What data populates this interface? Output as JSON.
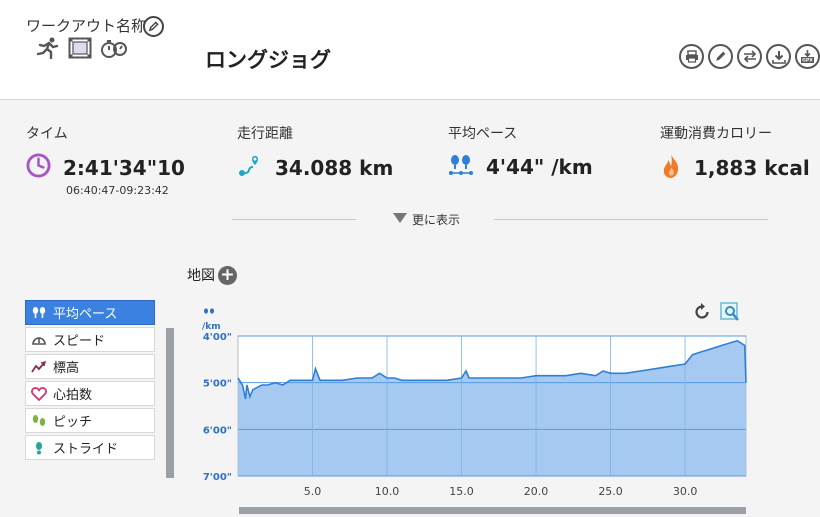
{
  "header": {
    "workout_name_label": "ワークアウト名称",
    "title": "ロングジョグ",
    "tools": [
      "print-icon",
      "edit-icon",
      "swap-icon",
      "download-icon",
      "gpx-export-icon"
    ]
  },
  "stats": {
    "time": {
      "label": "タイム",
      "value": "2:41'34\"10",
      "range": "06:40:47-09:23:42",
      "icon": "clock-icon",
      "color": "#a855c7"
    },
    "distance": {
      "label": "走行距離",
      "value": "34.088 km",
      "icon": "route-icon",
      "color": "#1aa7c9"
    },
    "pace": {
      "label": "平均ペース",
      "value": "4'44\" /km",
      "icon": "pace-icon",
      "color": "#2f7fd8"
    },
    "calories": {
      "label": "運動消費カロリー",
      "value": "1,883 kcal",
      "icon": "flame-icon",
      "color": "#f07a2a"
    },
    "more_label": "更に表示"
  },
  "map": {
    "label": "地図"
  },
  "metrics": [
    {
      "label": "平均ペース",
      "icon": "pace-icon",
      "active": true
    },
    {
      "label": "スピード",
      "icon": "speedometer-icon",
      "active": false
    },
    {
      "label": "標高",
      "icon": "elevation-icon",
      "active": false
    },
    {
      "label": "心拍数",
      "icon": "heart-icon",
      "active": false
    },
    {
      "label": "ピッチ",
      "icon": "footsteps-icon",
      "active": false
    },
    {
      "label": "ストライド",
      "icon": "stride-icon",
      "active": false
    }
  ],
  "chart_data": {
    "type": "area",
    "y_unit": "/km",
    "y_ticks": [
      "4'00\"",
      "5'00\"",
      "6'00\"",
      "7'00\""
    ],
    "y_tick_values": [
      4,
      5,
      6,
      7
    ],
    "ylim": [
      4,
      7
    ],
    "y_inverted": true,
    "xlim": [
      0,
      34.088
    ],
    "x_ticks": [
      "5.0",
      "10.0",
      "15.0",
      "20.0",
      "25.0",
      "30.0"
    ],
    "x_tick_values": [
      5,
      10,
      15,
      20,
      25,
      30
    ],
    "grid": true,
    "color": "#2f7fd8",
    "fill": "#a6c9f2",
    "x": [
      0,
      0.3,
      0.5,
      0.6,
      0.8,
      1.0,
      1.3,
      1.6,
      2.0,
      2.5,
      3.0,
      3.5,
      4.0,
      4.5,
      5.0,
      5.2,
      5.5,
      6.0,
      7.0,
      8.0,
      9.0,
      9.5,
      10.0,
      10.5,
      11.0,
      12.0,
      13.0,
      14.0,
      15.0,
      15.3,
      15.5,
      16.0,
      17.0,
      18.0,
      19.0,
      20.0,
      21.0,
      22.0,
      23.0,
      24.0,
      24.5,
      25.0,
      26.0,
      27.0,
      28.0,
      29.0,
      30.0,
      30.5,
      31.0,
      31.5,
      32.0,
      32.5,
      33.0,
      33.5,
      34.0,
      34.088
    ],
    "y": [
      4.9,
      5.05,
      5.35,
      5.05,
      5.3,
      5.15,
      5.1,
      5.05,
      5.05,
      5.0,
      5.05,
      4.95,
      4.95,
      4.95,
      4.95,
      4.7,
      4.95,
      4.95,
      4.95,
      4.9,
      4.9,
      4.8,
      4.9,
      4.9,
      4.95,
      4.95,
      4.95,
      4.95,
      4.9,
      4.75,
      4.9,
      4.9,
      4.9,
      4.9,
      4.9,
      4.85,
      4.85,
      4.85,
      4.8,
      4.85,
      4.75,
      4.8,
      4.8,
      4.75,
      4.7,
      4.65,
      4.6,
      4.4,
      4.35,
      4.3,
      4.25,
      4.2,
      4.15,
      4.1,
      4.2,
      5.0
    ]
  }
}
